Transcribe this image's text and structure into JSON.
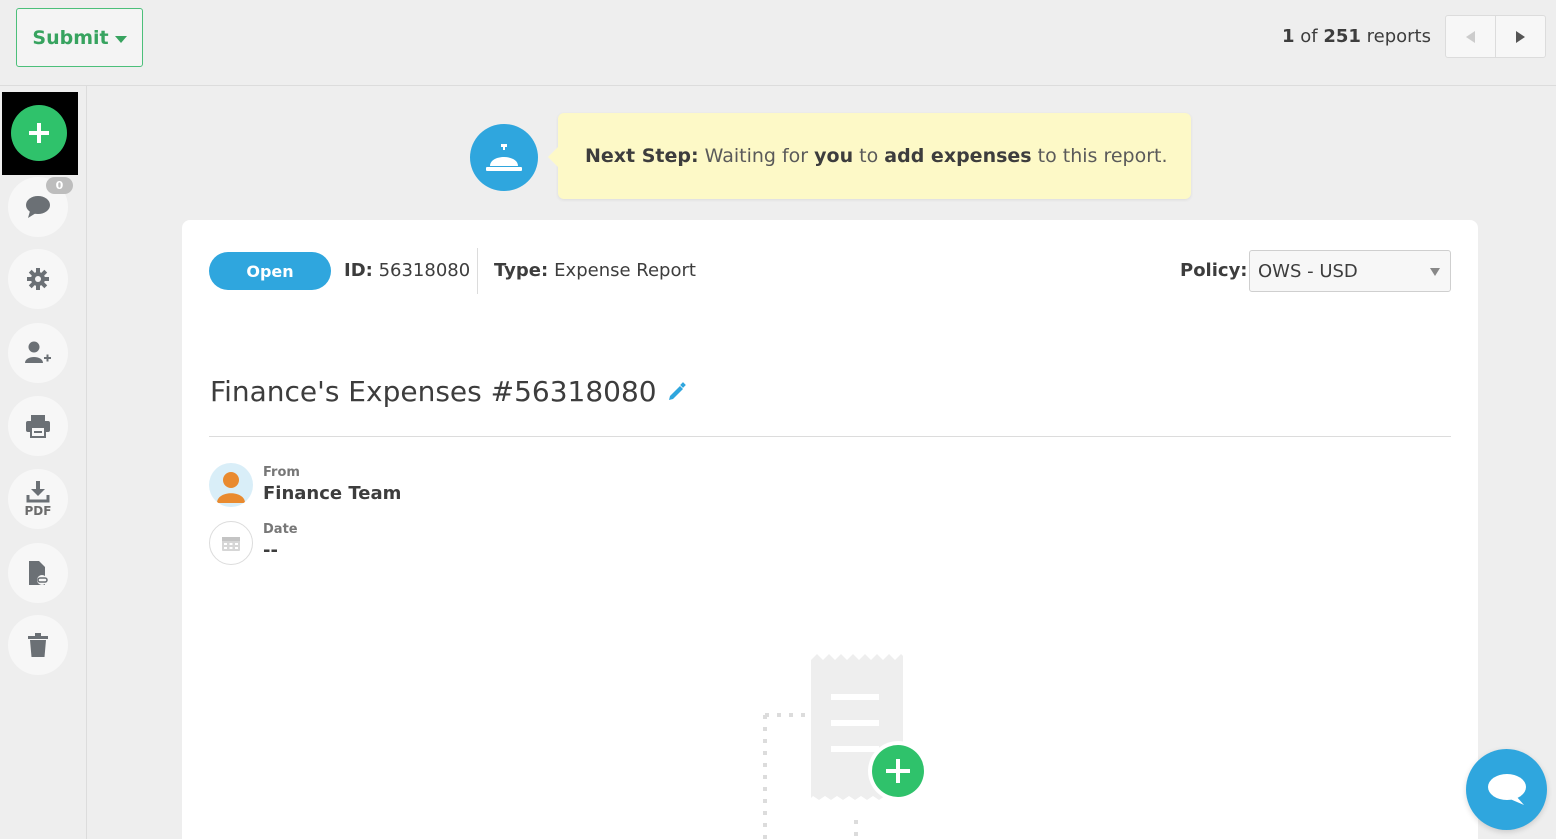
{
  "toolbar": {
    "submit_label": "Submit",
    "report_count_current": "1",
    "report_count_of": " of ",
    "report_count_total": "251",
    "report_count_suffix": " reports"
  },
  "sidebar": {
    "comment_badge": "0",
    "pdf_label": "PDF",
    "items": [
      "add-icon",
      "comment-icon",
      "gear-icon",
      "add-user-icon",
      "print-icon",
      "download-pdf-icon",
      "attach-document-icon",
      "trash-icon"
    ]
  },
  "next_step": {
    "prefix": "Next Step:",
    "text_1": " Waiting for ",
    "you": "you",
    "text_2": " to ",
    "action": "add expenses",
    "text_3": " to this report."
  },
  "report": {
    "status": "Open",
    "id_label": "ID:",
    "id_value": "56318080",
    "type_label": "Type:",
    "type_value": "Expense Report",
    "policy_label": "Policy:",
    "policy_value": "OWS - USD",
    "title": "Finance's Expenses #56318080",
    "from_label": "From",
    "from_value": "Finance Team",
    "date_label": "Date",
    "date_value": "--"
  },
  "colors": {
    "brand_green": "#2fc26b",
    "brand_blue": "#2fa6de",
    "next_step_bg": "#fdf9c7"
  }
}
